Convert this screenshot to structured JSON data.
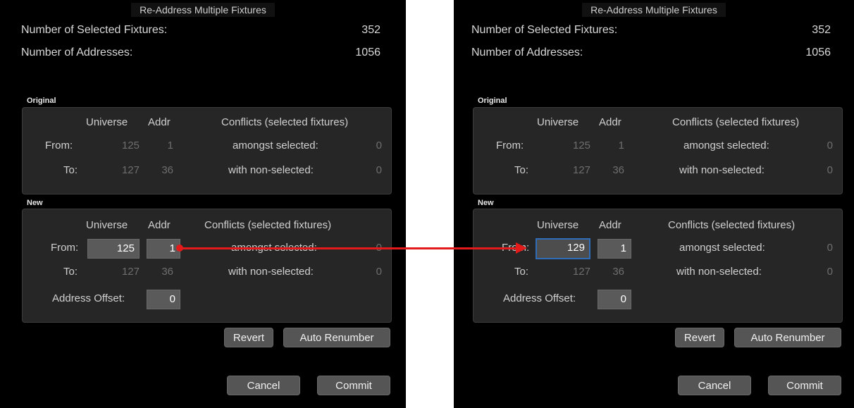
{
  "left": {
    "title": "Re-Address Multiple Fixtures",
    "summary": {
      "selected_label": "Number of Selected Fixtures:",
      "selected_value": "352",
      "addresses_label": "Number of Addresses:",
      "addresses_value": "1056"
    },
    "original": {
      "label": "Original",
      "col_universe": "Universe",
      "col_addr": "Addr",
      "col_conflicts": "Conflicts (selected fixtures)",
      "from_label": "From:",
      "from_universe": "125",
      "from_addr": "1",
      "to_label": "To:",
      "to_universe": "127",
      "to_addr": "36",
      "amongst_label": "amongst selected:",
      "amongst_value": "0",
      "nonsel_label": "with non-selected:",
      "nonsel_value": "0"
    },
    "new": {
      "label": "New",
      "col_universe": "Universe",
      "col_addr": "Addr",
      "col_conflicts": "Conflicts (selected fixtures)",
      "from_label": "From:",
      "from_universe": "125",
      "from_addr": "1",
      "to_label": "To:",
      "to_universe": "127",
      "to_addr": "36",
      "offset_label": "Address Offset:",
      "offset_value": "0",
      "amongst_label": "amongst selected:",
      "amongst_value": "0",
      "nonsel_label": "with non-selected:",
      "nonsel_value": "0"
    },
    "buttons": {
      "revert": "Revert",
      "auto_renumber": "Auto Renumber",
      "cancel": "Cancel",
      "commit": "Commit"
    }
  },
  "right": {
    "title": "Re-Address Multiple Fixtures",
    "summary": {
      "selected_label": "Number of Selected Fixtures:",
      "selected_value": "352",
      "addresses_label": "Number of Addresses:",
      "addresses_value": "1056"
    },
    "original": {
      "label": "Original",
      "col_universe": "Universe",
      "col_addr": "Addr",
      "col_conflicts": "Conflicts (selected fixtures)",
      "from_label": "From:",
      "from_universe": "125",
      "from_addr": "1",
      "to_label": "To:",
      "to_universe": "127",
      "to_addr": "36",
      "amongst_label": "amongst selected:",
      "amongst_value": "0",
      "nonsel_label": "with non-selected:",
      "nonsel_value": "0"
    },
    "new": {
      "label": "New",
      "col_universe": "Universe",
      "col_addr": "Addr",
      "col_conflicts": "Conflicts (selected fixtures)",
      "from_label": "From:",
      "from_universe": "129",
      "from_addr": "1",
      "to_label": "To:",
      "to_universe": "127",
      "to_addr": "36",
      "offset_label": "Address Offset:",
      "offset_value": "0",
      "amongst_label": "amongst selected:",
      "amongst_value": "0",
      "nonsel_label": "with non-selected:",
      "nonsel_value": "0"
    },
    "buttons": {
      "revert": "Revert",
      "auto_renumber": "Auto Renumber",
      "cancel": "Cancel",
      "commit": "Commit"
    }
  },
  "colors": {
    "background": "#000000",
    "panel": "#262626",
    "field": "#5a5a5a",
    "focus_ring": "#2f6db8",
    "arrow": "#e21a1a"
  }
}
